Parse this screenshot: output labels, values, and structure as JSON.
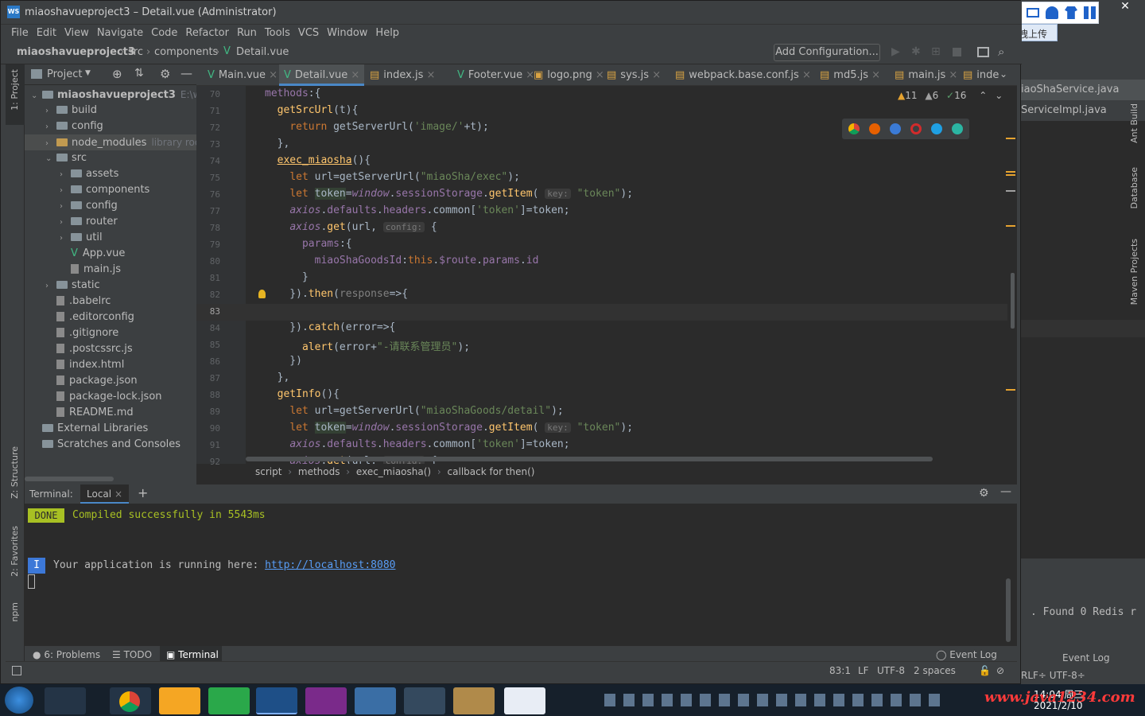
{
  "window": {
    "title": "miaoshavueproject3 – Detail.vue (Administrator)",
    "ws_badge": "WS"
  },
  "menu": [
    "File",
    "Edit",
    "View",
    "Navigate",
    "Code",
    "Refactor",
    "Run",
    "Tools",
    "VCS",
    "Window",
    "Help"
  ],
  "breadcrumb": {
    "project": "miaoshavueproject3",
    "p1": "src",
    "p2": "components",
    "file": "Detail.vue"
  },
  "run_config": "Add Configuration...",
  "project_panel": {
    "title": "Project",
    "tree": [
      {
        "label": "miaoshavueproject3",
        "extra": "E:\\work",
        "kind": "folder",
        "depth": 0,
        "open": true
      },
      {
        "label": "build",
        "kind": "folder",
        "depth": 1
      },
      {
        "label": "config",
        "kind": "folder",
        "depth": 1
      },
      {
        "label": "node_modules",
        "extra": "library root",
        "kind": "folder",
        "depth": 1,
        "selected": true
      },
      {
        "label": "src",
        "kind": "folder",
        "depth": 1,
        "open": true
      },
      {
        "label": "assets",
        "kind": "folder",
        "depth": 2
      },
      {
        "label": "components",
        "kind": "folder",
        "depth": 2
      },
      {
        "label": "config",
        "kind": "folder",
        "depth": 2
      },
      {
        "label": "router",
        "kind": "folder",
        "depth": 2
      },
      {
        "label": "util",
        "kind": "folder",
        "depth": 2
      },
      {
        "label": "App.vue",
        "kind": "vue",
        "depth": 2
      },
      {
        "label": "main.js",
        "kind": "file",
        "depth": 2
      },
      {
        "label": "static",
        "kind": "folder",
        "depth": 1
      },
      {
        "label": ".babelrc",
        "kind": "file",
        "depth": 1
      },
      {
        "label": ".editorconfig",
        "kind": "file",
        "depth": 1
      },
      {
        "label": ".gitignore",
        "kind": "file",
        "depth": 1
      },
      {
        "label": ".postcssrc.js",
        "kind": "file",
        "depth": 1
      },
      {
        "label": "index.html",
        "kind": "file",
        "depth": 1
      },
      {
        "label": "package.json",
        "kind": "file",
        "depth": 1
      },
      {
        "label": "package-lock.json",
        "kind": "file",
        "depth": 1
      },
      {
        "label": "README.md",
        "kind": "file",
        "depth": 1
      },
      {
        "label": "External Libraries",
        "kind": "lib",
        "depth": 0
      },
      {
        "label": "Scratches and Consoles",
        "kind": "lib",
        "depth": 0
      }
    ]
  },
  "tabs": [
    "Main.vue",
    "Detail.vue",
    "index.js",
    "Footer.vue",
    "logo.png",
    "sys.js",
    "webpack.base.conf.js",
    "md5.js",
    "main.js",
    "inde"
  ],
  "inspections": {
    "warn1": "11",
    "warn2": "6",
    "ok": "16"
  },
  "line_numbers": [
    "70",
    "71",
    "72",
    "73",
    "74",
    "75",
    "76",
    "77",
    "78",
    "79",
    "80",
    "81",
    "82",
    "83",
    "84",
    "85",
    "86",
    "87",
    "88",
    "89",
    "90",
    "91",
    "92"
  ],
  "editor_breadcrumb": [
    "script",
    "methods",
    "exec_miaosha()",
    "callback for then()"
  ],
  "terminal": {
    "title": "Terminal:",
    "tab": "Local",
    "done_badge": "DONE",
    "compiled_msg": "Compiled successfully in 5543ms",
    "info_badge": "I",
    "running_msg": "Your application is running here: ",
    "url": "http://localhost:8080"
  },
  "bottom_tabs": {
    "problems": "6: Problems",
    "todo": "TODO",
    "terminal": "Terminal",
    "event_log": "Event Log"
  },
  "status": {
    "pos": "83:1",
    "lf": "LF",
    "enc": "UTF-8",
    "indent": "2 spaces"
  },
  "left_tool_labels": {
    "project": "1: Project",
    "structure": "Z: Structure",
    "favorites": "2: Favorites",
    "npm": "npm"
  },
  "right_tool_labels": {
    "ant": "Ant Build",
    "database": "Database",
    "maven": "Maven Projects"
  },
  "bg_window": {
    "tab1": "iaoShaService.java",
    "tab2": "ServiceImpl.java",
    "console": ". Found 0 Redis r",
    "event_log": "Event Log",
    "status": "RLF÷ UTF-8÷"
  },
  "ime": {
    "lang": "英",
    "upload": "拖拽上传"
  },
  "taskbar": {
    "time": "14:04 周三",
    "date": "2021/2/10",
    "watermark": "www.java1234.com"
  },
  "colors": {
    "accent": "#4a88c7",
    "done": "#a8c023",
    "bg": "#2b2b2b",
    "panel": "#3c3f41"
  }
}
